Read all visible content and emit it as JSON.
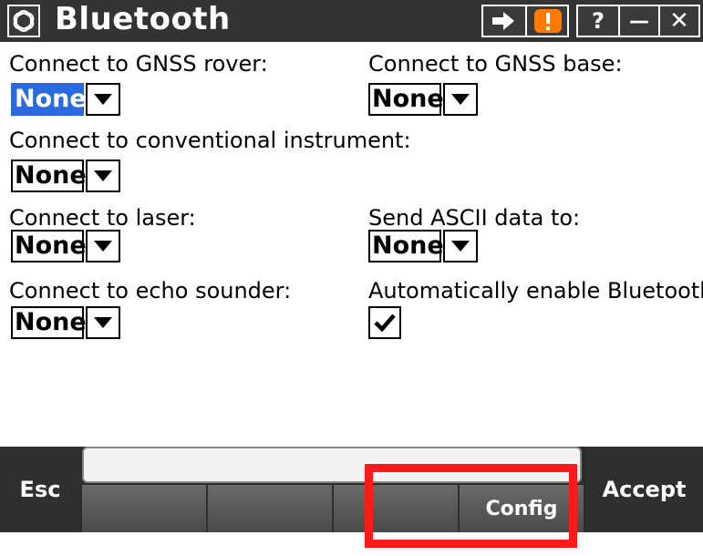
{
  "window": {
    "title": "Bluetooth",
    "buttons": {
      "help": "?",
      "minimize": "—",
      "close": "✕",
      "nav": "→",
      "warning": "!"
    }
  },
  "fields": {
    "gnss_rover": {
      "label": "Connect to GNSS rover:",
      "value": "None",
      "selected": true
    },
    "gnss_base": {
      "label": "Connect to GNSS base:",
      "value": "None"
    },
    "conventional": {
      "label": "Connect to conventional instrument:",
      "value": "None"
    },
    "laser": {
      "label": "Connect to laser:",
      "value": "None"
    },
    "ascii": {
      "label": "Send ASCII data to:",
      "value": "None"
    },
    "echo": {
      "label": "Connect to echo sounder:",
      "value": "None"
    },
    "auto_enable": {
      "label": "Automatically enable Bluetooth:",
      "checked": true
    }
  },
  "bottombar": {
    "esc": "Esc",
    "accept": "Accept",
    "softkeys": [
      "",
      "",
      "",
      "Config"
    ]
  },
  "colors": {
    "selected_bg": "#2a6ae0",
    "highlight": "#ff1a1a",
    "warning": "#ff7a00"
  },
  "icons": {
    "app": "trimble-globe-icon",
    "nav": "arrow-right-icon",
    "warning": "warning-icon",
    "dropdown": "chevron-down-icon",
    "checkbox": "check-icon"
  }
}
